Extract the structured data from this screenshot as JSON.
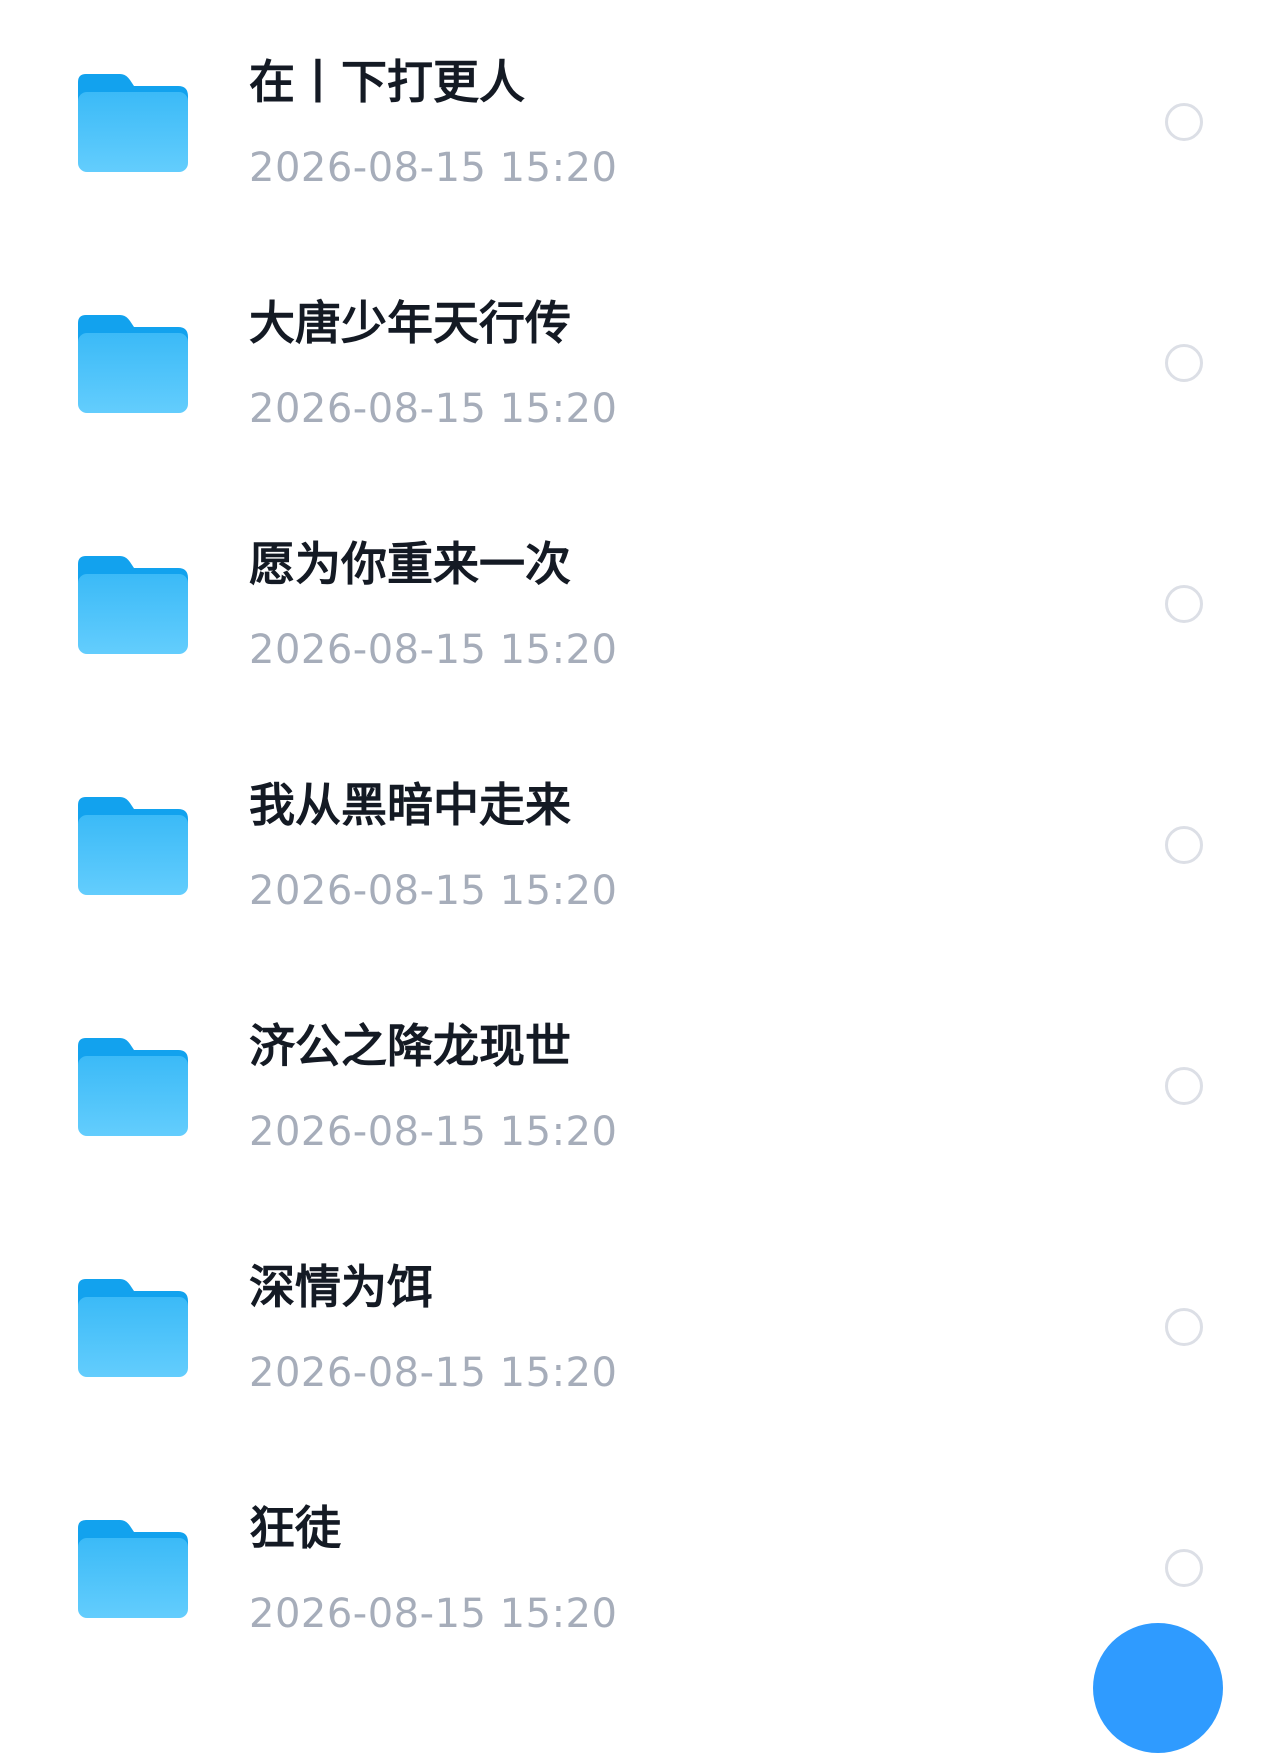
{
  "colors": {
    "folder_top": "#1aa7f2",
    "folder_bottom": "#5cc8ff",
    "title_text": "#141a24",
    "date_text": "#a6adba",
    "radio_border": "#dcdfe6",
    "fab": "#2f9bff"
  },
  "files": [
    {
      "icon": "folder-icon",
      "name": "在丨下打更人",
      "date": "2026-08-15 15:20",
      "selected": false
    },
    {
      "icon": "folder-icon",
      "name": "大唐少年天行传",
      "date": "2026-08-15 15:20",
      "selected": false
    },
    {
      "icon": "folder-icon",
      "name": "愿为你重来一次",
      "date": "2026-08-15 15:20",
      "selected": false
    },
    {
      "icon": "folder-icon",
      "name": "我从黑暗中走来",
      "date": "2026-08-15 15:20",
      "selected": false
    },
    {
      "icon": "folder-icon",
      "name": "济公之降龙现世",
      "date": "2026-08-15 15:20",
      "selected": false
    },
    {
      "icon": "folder-icon",
      "name": "深情为饵",
      "date": "2026-08-15 15:20",
      "selected": false
    },
    {
      "icon": "folder-icon",
      "name": "狂徒",
      "date": "2026-08-15 15:20",
      "selected": false
    }
  ],
  "fab": {
    "icon": "add-icon"
  }
}
